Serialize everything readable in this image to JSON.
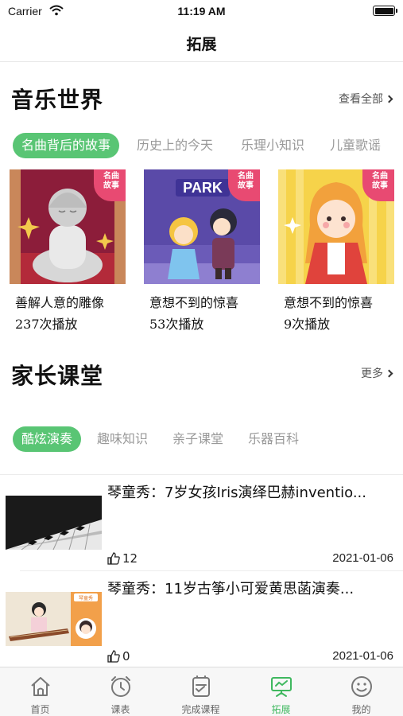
{
  "status_bar": {
    "carrier": "Carrier",
    "time": "11:19 AM"
  },
  "nav": {
    "title": "拓展"
  },
  "music": {
    "title": "音乐世界",
    "more_label": "查看全部",
    "tabs": [
      {
        "label": "名曲背后的故事",
        "active": true
      },
      {
        "label": "历史上的今天",
        "active": false
      },
      {
        "label": "乐理小知识",
        "active": false
      },
      {
        "label": "儿童歌谣",
        "active": false
      }
    ],
    "cards": [
      {
        "title": "善解人意的雕像",
        "plays": "237次播放",
        "badge": "名曲故事"
      },
      {
        "title": "意想不到的惊喜",
        "plays": "53次播放",
        "badge": "名曲故事",
        "sign": "PARK"
      },
      {
        "title": "意想不到的惊喜",
        "plays": "9次播放",
        "badge": "名曲故事"
      }
    ]
  },
  "parents": {
    "title": "家长课堂",
    "more_label": "更多",
    "tabs": [
      {
        "label": "酷炫演奏",
        "active": true
      },
      {
        "label": "趣味知识",
        "active": false
      },
      {
        "label": "亲子课堂",
        "active": false
      },
      {
        "label": "乐器百科",
        "active": false
      }
    ],
    "videos": [
      {
        "title": "琴童秀：7岁女孩Iris演绎巴赫inventio...",
        "likes": "12",
        "date": "2021-01-06"
      },
      {
        "title": "琴童秀：11岁古筝小可爱黄思菡演奏...",
        "likes": "0",
        "date": "2021-01-06",
        "thumb_label": "琴童秀"
      }
    ]
  },
  "tab_bar": {
    "items": [
      {
        "label": "首页",
        "icon": "home-icon",
        "active": false
      },
      {
        "label": "课表",
        "icon": "clock-icon",
        "active": false
      },
      {
        "label": "完成课程",
        "icon": "checklist-icon",
        "active": false
      },
      {
        "label": "拓展",
        "icon": "board-icon",
        "active": true
      },
      {
        "label": "我的",
        "icon": "smile-icon",
        "active": false
      }
    ]
  },
  "colors": {
    "accent": "#59c574",
    "badge": "#e84a72",
    "tab_active": "#3fb85f"
  }
}
